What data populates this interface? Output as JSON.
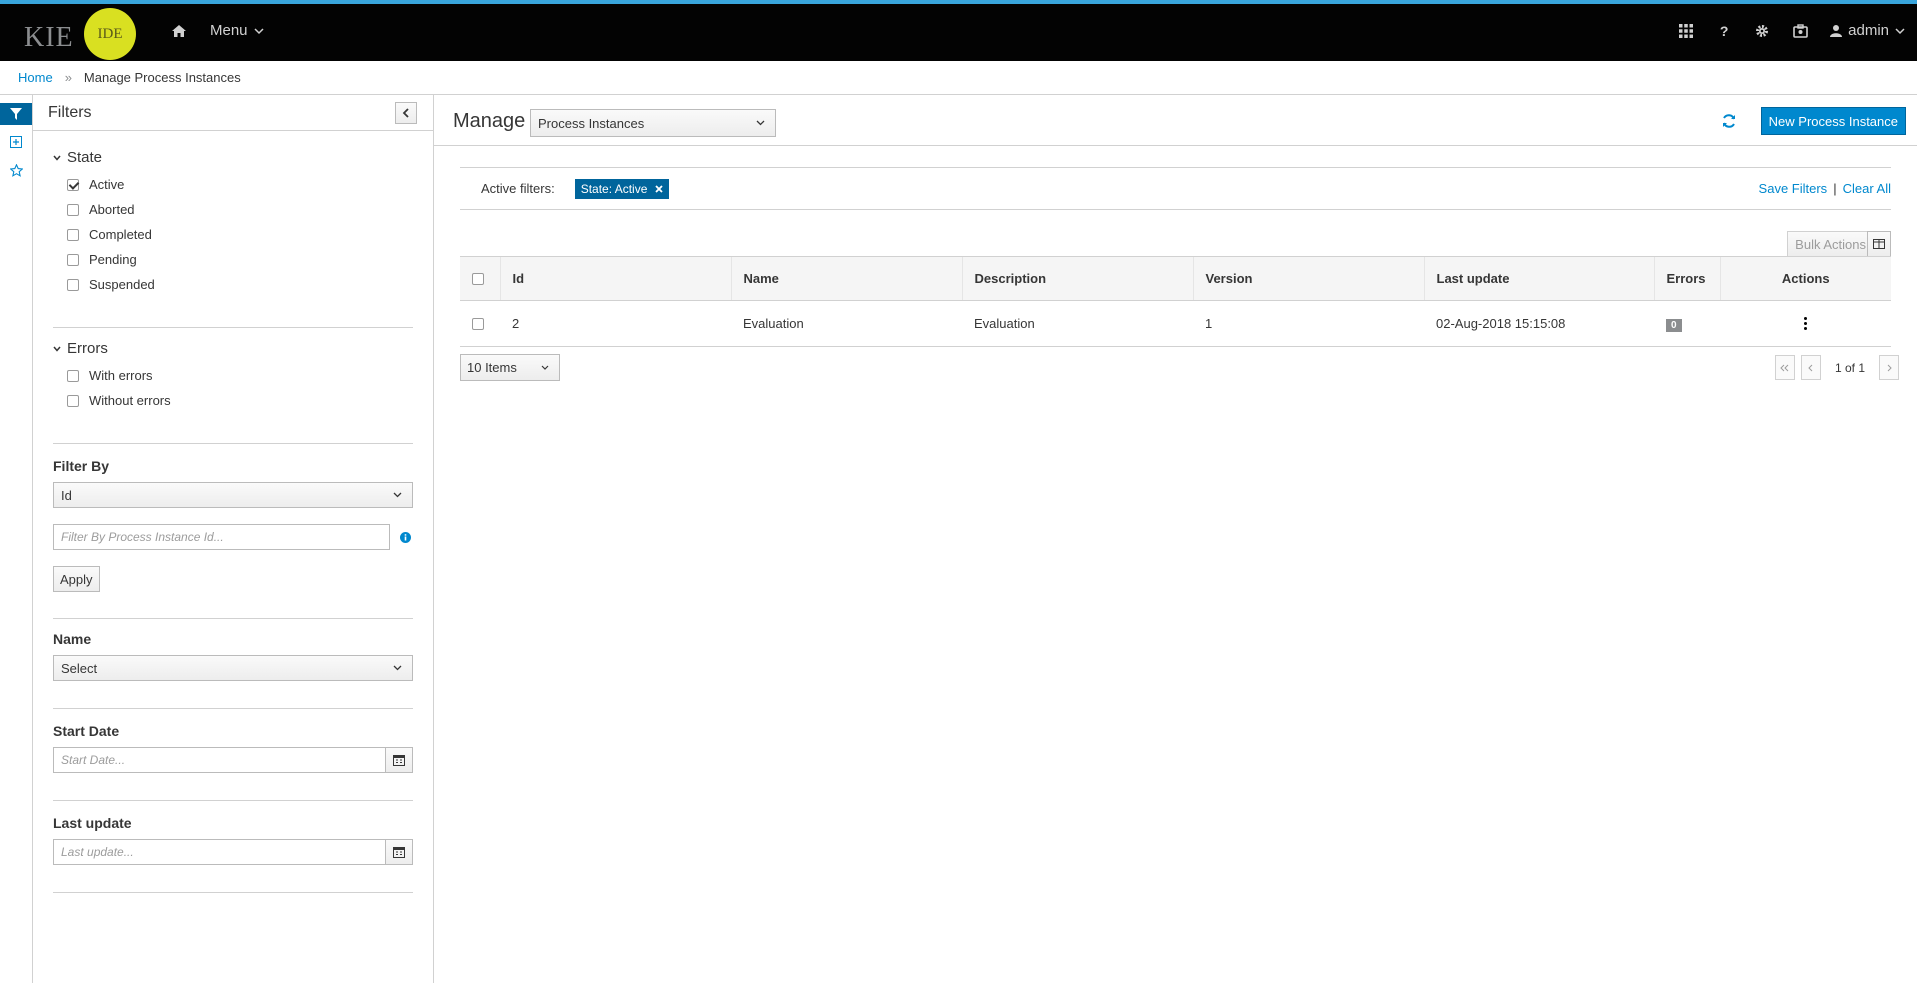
{
  "header": {
    "logo_text": "KIE",
    "logo_badge": "IDE",
    "menu_label": "Menu",
    "user_label": "admin",
    "help_label": "?"
  },
  "breadcrumb": {
    "home": "Home",
    "sep": "»",
    "current": "Manage Process Instances"
  },
  "filters": {
    "title": "Filters",
    "state": {
      "title": "State",
      "items": [
        {
          "label": "Active",
          "checked": true
        },
        {
          "label": "Aborted",
          "checked": false
        },
        {
          "label": "Completed",
          "checked": false
        },
        {
          "label": "Pending",
          "checked": false
        },
        {
          "label": "Suspended",
          "checked": false
        }
      ]
    },
    "errors": {
      "title": "Errors",
      "items": [
        {
          "label": "With errors",
          "checked": false
        },
        {
          "label": "Without errors",
          "checked": false
        }
      ]
    },
    "filter_by": {
      "title": "Filter By",
      "selected": "Id",
      "placeholder": "Filter By Process Instance Id...",
      "apply": "Apply"
    },
    "name": {
      "title": "Name",
      "selected": "Select"
    },
    "start_date": {
      "title": "Start Date",
      "placeholder": "Start Date..."
    },
    "last_update": {
      "title": "Last update",
      "placeholder": "Last update..."
    }
  },
  "main": {
    "title": "Manage",
    "view_select": "Process Instances",
    "new_button": "New Process Instance",
    "active_filters_label": "Active filters:",
    "chip": "State: Active",
    "save_filters": "Save Filters",
    "sep": "|",
    "clear_all": "Clear All",
    "bulk_actions": "Bulk Actions",
    "columns": [
      "Id",
      "Name",
      "Description",
      "Version",
      "Last update",
      "Errors",
      "Actions"
    ],
    "rows": [
      {
        "id": "2",
        "name": "Evaluation",
        "description": "Evaluation",
        "version": "1",
        "last_update": "02-Aug-2018 15:15:08",
        "errors": "0"
      }
    ],
    "page_size": "10 Items",
    "page_text": "1 of 1"
  },
  "colors": {
    "accent": "#0088ce",
    "chip": "#00659c",
    "topbar": "#030303",
    "logo": "#d9e021"
  }
}
